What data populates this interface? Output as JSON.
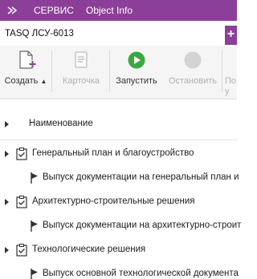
{
  "topbar": {
    "menu_service": "СЕРВИС",
    "menu_object_info": "Object Info",
    "color": "#8c3f98"
  },
  "tabs": [
    {
      "label": "TASQ ЛСУ-6013"
    }
  ],
  "tab_add_label": "+",
  "ribbon": {
    "create": "Создать",
    "card": "Карточка",
    "run": "Запустить",
    "stop": "Остановить",
    "more": "По у"
  },
  "tree": {
    "header": "Наименование",
    "rows": [
      {
        "label": "Генеральный план и благоустройство"
      },
      {
        "label": "Выпуск документации на генеральный план и"
      },
      {
        "label": "Архитектурно-строительные решения"
      },
      {
        "label": "Выпуск документации на архитектурно-строит"
      },
      {
        "label": "Технологические решения"
      },
      {
        "label": "Выпуск основной технологической документа"
      }
    ]
  }
}
